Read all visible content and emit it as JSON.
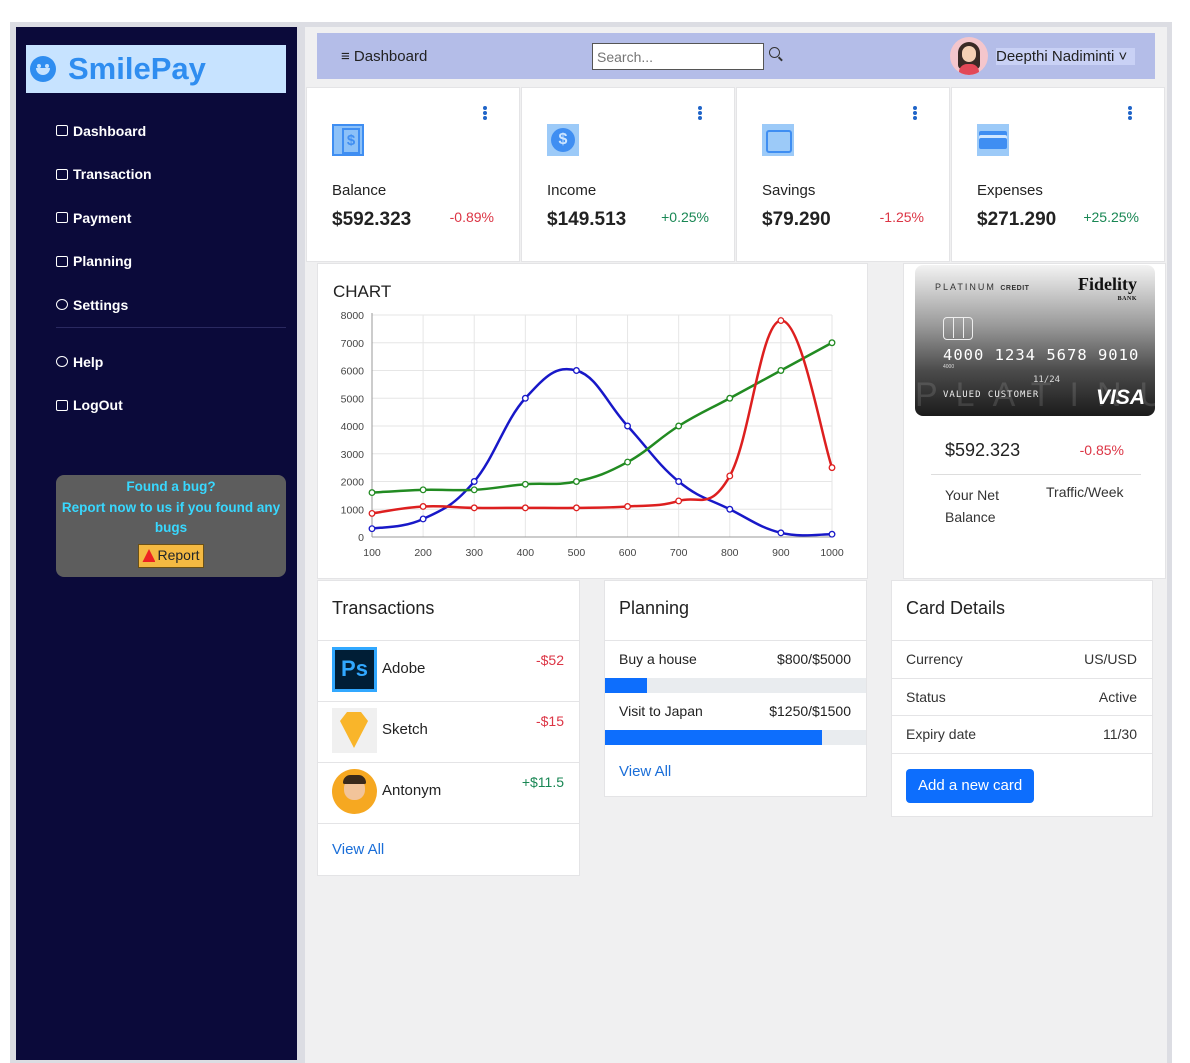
{
  "brand": {
    "name": "SmilePay"
  },
  "sidebar": {
    "items": [
      {
        "label": "Dashboard",
        "icon": "grid-icon"
      },
      {
        "label": "Transaction",
        "icon": "card-icon"
      },
      {
        "label": "Payment",
        "icon": "cash-icon"
      },
      {
        "label": "Planning",
        "icon": "list-icon"
      },
      {
        "label": "Settings",
        "icon": "gear-icon"
      }
    ],
    "secondary": [
      {
        "label": "Help",
        "icon": "help-icon"
      },
      {
        "label": "LogOut",
        "icon": "logout-icon"
      }
    ],
    "bug": {
      "title": "Found a bug?",
      "text": "Report now to us if you found any bugs",
      "button": "Report"
    }
  },
  "topbar": {
    "menu_label": "≡ Dashboard",
    "search_placeholder": "Search...",
    "user_name": "Deepthi Nadiminti ˅"
  },
  "stats": [
    {
      "label": "Balance",
      "amount": "$592.323",
      "change": "-0.89%",
      "trend": "negative"
    },
    {
      "label": "Income",
      "amount": "$149.513",
      "change": "+0.25%",
      "trend": "positive"
    },
    {
      "label": "Savings",
      "amount": "$79.290",
      "change": "-1.25%",
      "trend": "negative"
    },
    {
      "label": "Expenses",
      "amount": "$271.290",
      "change": "+25.25%",
      "trend": "positive"
    }
  ],
  "colors": {
    "accent": "#0d6efd",
    "negative": "#dc3545",
    "positive": "#198754",
    "sidebar": "#0b0a3a"
  },
  "chart_data": {
    "type": "line",
    "title": "CHART",
    "x": [
      100,
      200,
      300,
      400,
      500,
      600,
      700,
      800,
      900,
      1000
    ],
    "xlim": [
      100,
      1000
    ],
    "ylim": [
      0,
      8000
    ],
    "yticks": [
      0,
      1000,
      2000,
      3000,
      4000,
      5000,
      6000,
      7000,
      8000
    ],
    "grid": true,
    "series": [
      {
        "color": "#1818c8",
        "values": [
          300,
          650,
          2000,
          5000,
          6000,
          4000,
          2000,
          1000,
          150,
          100
        ]
      },
      {
        "color": "#228b22",
        "values": [
          1600,
          1700,
          1700,
          1900,
          2000,
          2700,
          4000,
          5000,
          6000,
          7000
        ]
      },
      {
        "color": "#dd1f1f",
        "values": [
          850,
          1100,
          1050,
          1050,
          1050,
          1100,
          1300,
          2200,
          7800,
          2500
        ]
      }
    ]
  },
  "credit_card": {
    "tier": "PLATINUM",
    "tier_sub": "CREDIT",
    "bank": "Fidelity",
    "bank_sub": "BANK",
    "number": "4000 1234 5678 9010",
    "number_small": "4000",
    "expiry": "11/24",
    "holder": "VALUED CUSTOMER",
    "watermark": "PLATINUM",
    "network": "VISA",
    "balance": "$592.323",
    "change": "-0.85%",
    "net_label": "Your Net Balance",
    "traffic_label": "Traffic/Week"
  },
  "transactions": {
    "title": "Transactions",
    "items": [
      {
        "name": "Adobe",
        "amount": "-$52",
        "trend": "negative",
        "logo": "photoshop-logo"
      },
      {
        "name": "Sketch",
        "amount": "-$15",
        "trend": "negative",
        "logo": "sketch-logo"
      },
      {
        "name": "Antonym",
        "amount": "+$11.5",
        "trend": "positive",
        "logo": "antonym-avatar"
      }
    ],
    "view_all": "View All"
  },
  "planning": {
    "title": "Planning",
    "items": [
      {
        "name": "Buy a house",
        "value": "$800/$5000",
        "progress": 0.16
      },
      {
        "name": "Visit to Japan",
        "value": "$1250/$1500",
        "progress": 0.8333
      }
    ],
    "view_all": "View All"
  },
  "card_details": {
    "title": "Card Details",
    "rows": [
      {
        "key": "Currency",
        "value": "US/USD",
        "tone": "neutral"
      },
      {
        "key": "Status",
        "value": "Active",
        "tone": "positive"
      },
      {
        "key": "Expiry date",
        "value": "11/30",
        "tone": "negative"
      }
    ],
    "button": "Add a new card"
  }
}
